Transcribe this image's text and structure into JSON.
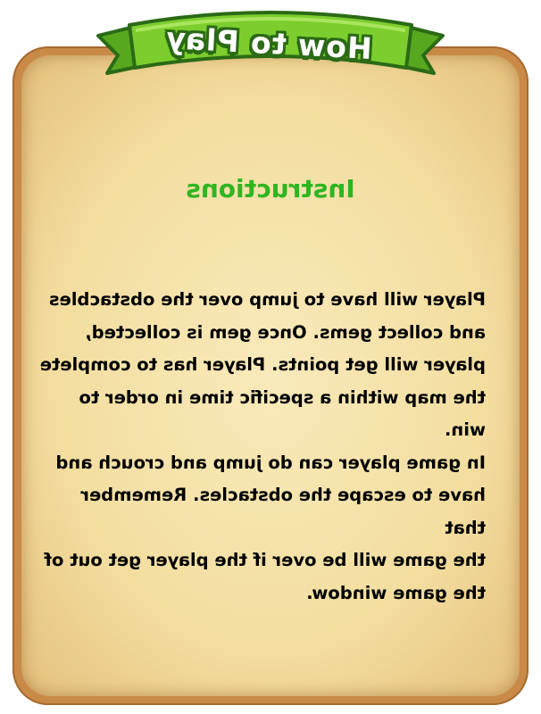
{
  "banner": {
    "title": "How to Play",
    "colors": {
      "fill": "#7cce2e",
      "outline": "#2b6a16",
      "text": "#ffffff"
    }
  },
  "panel": {
    "heading": "Instructions",
    "body": "Player will have to jump over the obstacbles\nand collect gems. Once gem is collected,\nplayer will get points. Player has to complete\nthe map within a specific time in order to win.\nIn game player can do jump and crouch and\nhave  to escape the obstacles. Remember that\nthe game will be over if  the player get out of\nthe game window.",
    "colors": {
      "parchment": "#f6e3ac",
      "frame": "#c98a48",
      "heading": "#2fb521"
    }
  }
}
